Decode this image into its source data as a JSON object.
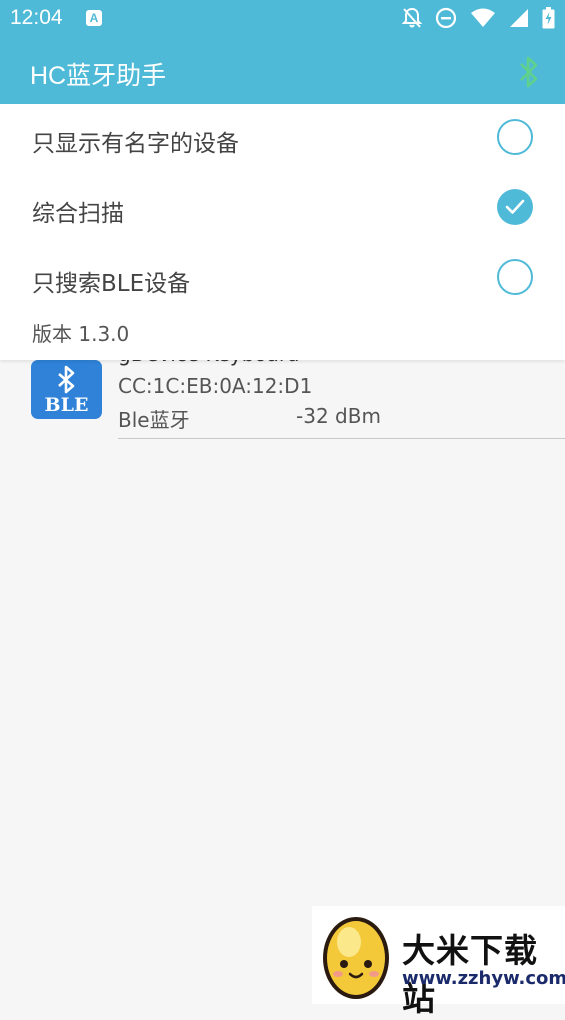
{
  "status_bar": {
    "time": "12:04",
    "notification_glyph": "A",
    "icons": [
      "notifications-off-icon",
      "do-not-disturb-icon",
      "wifi-icon",
      "signal-icon",
      "battery-charging-icon"
    ]
  },
  "app_bar": {
    "title": "HC蓝牙助手",
    "action_icon": "bluetooth-icon",
    "accent_color": "#4fbad7"
  },
  "menu": {
    "options": [
      {
        "label": "只显示有名字的设备",
        "checked": false
      },
      {
        "label": "综合扫描",
        "checked": true
      },
      {
        "label": "只搜索BLE设备",
        "checked": false
      }
    ],
    "version": "版本 1.3.0"
  },
  "device_list": [
    {
      "icon_text": "BLE",
      "name": "gDevice Keyboard",
      "address": "CC:1C:EB:0A:12:D1",
      "type": "Ble蓝牙",
      "rssi": "-32 dBm"
    }
  ],
  "watermark": {
    "brand": "大米下载站",
    "url": "www.zzhyw.com"
  }
}
